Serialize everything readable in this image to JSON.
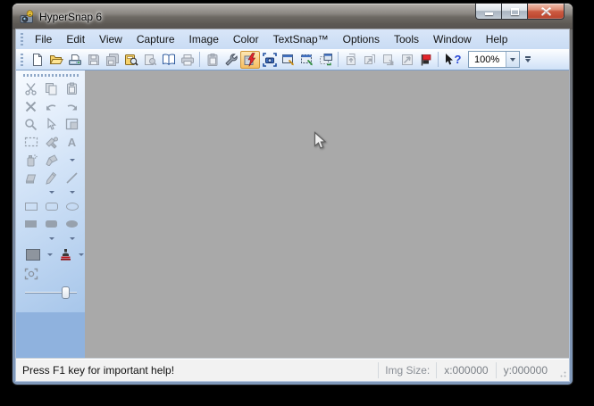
{
  "window": {
    "title": "HyperSnap 6"
  },
  "menu": {
    "items": [
      "File",
      "Edit",
      "View",
      "Capture",
      "Image",
      "Color",
      "TextSnap™",
      "Options",
      "Tools",
      "Window",
      "Help"
    ]
  },
  "toolbar": {
    "zoom_value": "100%",
    "icons": [
      "new",
      "open",
      "acquire",
      "save",
      "save-all",
      "browse-thumbnails",
      "print-preview",
      "help-book",
      "print",
      "paste",
      "setup-wrench",
      "quick-capture-active",
      "camera-capture",
      "window-capture",
      "region-capture",
      "repeat-capture",
      "send-1",
      "send-2",
      "send-3",
      "send-4",
      "stop-flag",
      "context-help"
    ]
  },
  "sidebar": {
    "text_tool_glyph": "A",
    "tools": [
      "cut",
      "copy",
      "paste",
      "delete",
      "undo",
      "redo",
      "zoom",
      "select",
      "fit-window",
      "selection-rect",
      "color-tools",
      "text",
      "spray",
      "highlight",
      "eraser",
      "pencil",
      "line",
      "rectangle",
      "rounded-rectangle",
      "ellipse",
      "filled-rectangle",
      "filled-rounded-rectangle",
      "filled-ellipse",
      "color-swatch",
      "stamp",
      "focus",
      "opacity-slider"
    ]
  },
  "icons": {
    "help_glyph": "?"
  },
  "statusbar": {
    "help_text": "Press F1 key for important help!",
    "img_size_label": "Img Size:",
    "x_value": "x:000000",
    "y_value": "y:000000"
  },
  "colors": {
    "canvas": "#a9a9a9",
    "sidebar": "#8fb2de",
    "menubar": "#cfe1f7",
    "active_tool_bg": "#f6bd60",
    "close_button": "#c24531",
    "titlebar_glass": "#6d6964"
  }
}
